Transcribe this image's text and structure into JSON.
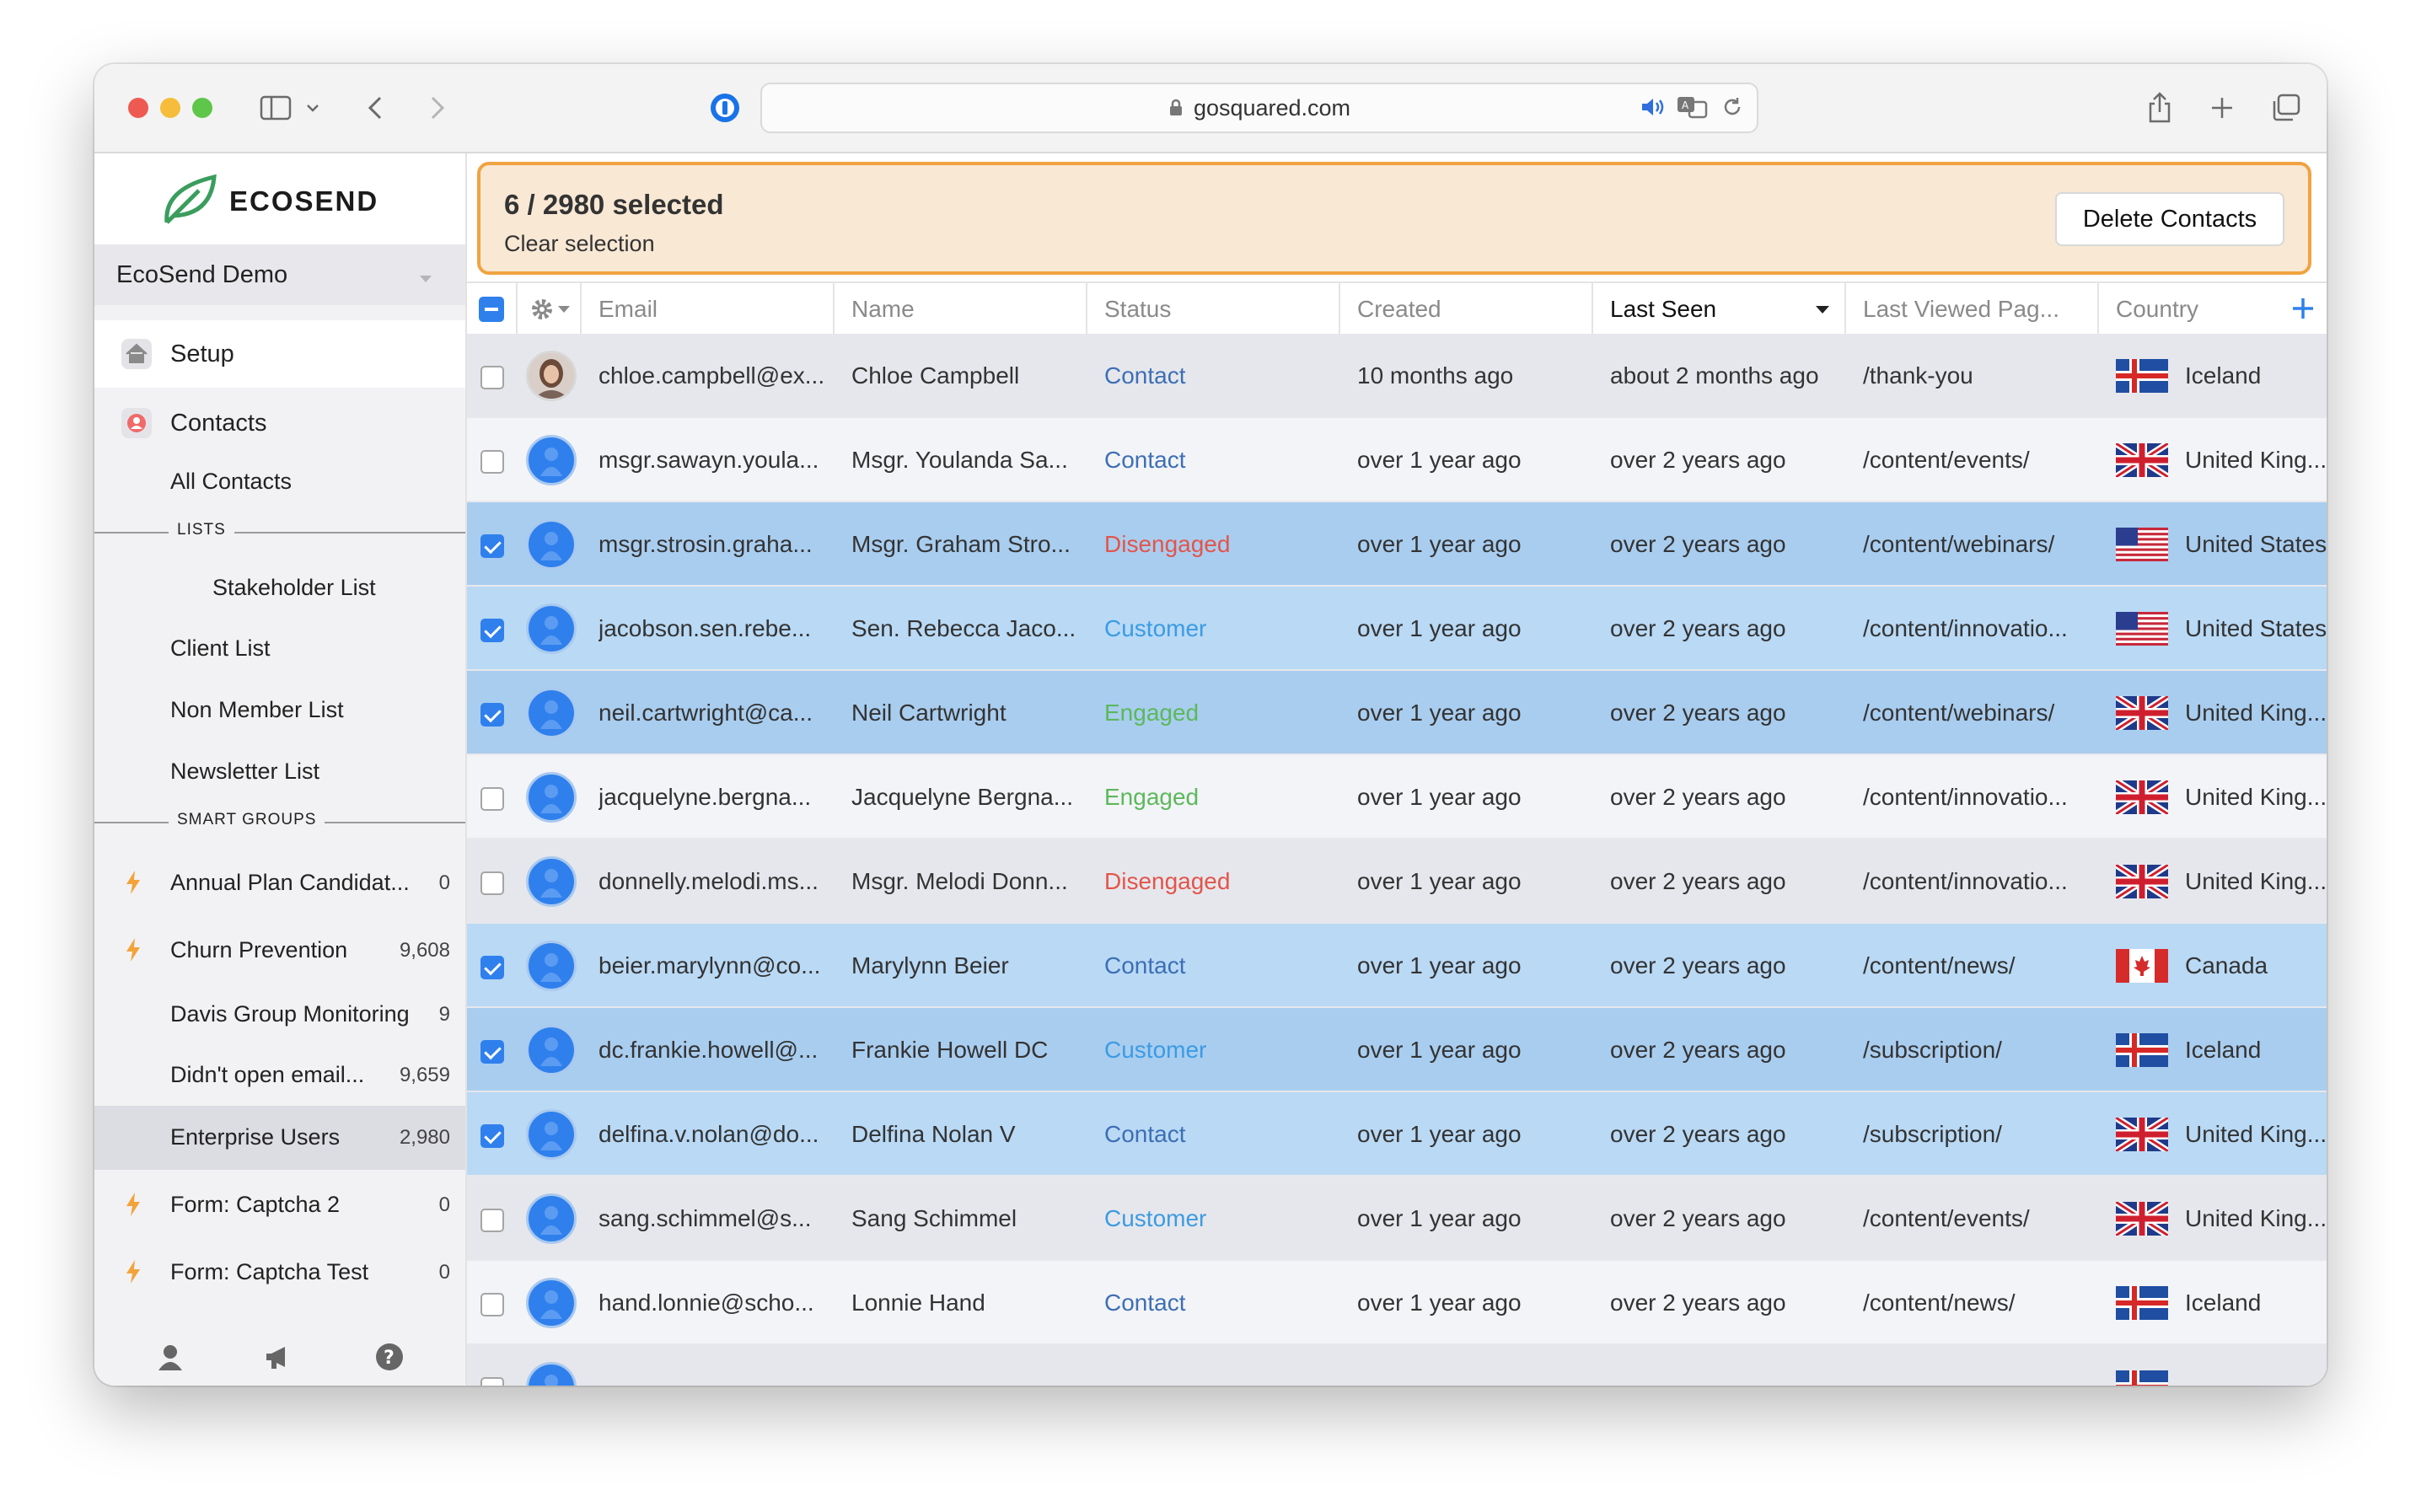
{
  "browser": {
    "url": "gosquared.com"
  },
  "sidebar": {
    "logo": "ECOSEND",
    "account": "EcoSend Demo",
    "setup": "Setup",
    "contacts": "Contacts",
    "all_contacts": "All Contacts",
    "lists_heading": "LISTS",
    "lists": [
      "Stakeholder List",
      "Client List",
      "Non Member List",
      "Newsletter List"
    ],
    "smart_groups_heading": "SMART GROUPS",
    "smart_groups": [
      {
        "label": "Annual Plan Candidat...",
        "count": "0",
        "bolt": true
      },
      {
        "label": "Churn Prevention",
        "count": "9,608",
        "bolt": true
      },
      {
        "label": "Davis Group Monitoring",
        "count": "9",
        "bolt": false
      },
      {
        "label": "Didn't open email...",
        "count": "9,659",
        "bolt": false
      },
      {
        "label": "Enterprise Users",
        "count": "2,980",
        "bolt": false,
        "active": true
      },
      {
        "label": "Form: Captcha 2",
        "count": "0",
        "bolt": true
      },
      {
        "label": "Form: Captcha Test",
        "count": "0",
        "bolt": true
      }
    ]
  },
  "selection": {
    "title": "6 / 2980 selected",
    "clear": "Clear selection",
    "delete_button": "Delete Contacts"
  },
  "table": {
    "columns": [
      "Email",
      "Name",
      "Status",
      "Created",
      "Last Seen",
      "Last Viewed Pag...",
      "Country"
    ],
    "status_colors": {
      "Contact": "#3d6fb4",
      "Customer": "#3c9be3",
      "Engaged": "#5cb85c",
      "Disengaged": "#e2554b"
    },
    "rows": [
      {
        "selected": false,
        "email": "chloe.campbell@ex...",
        "name": "Chloe Campbell",
        "status": "Contact",
        "created": "10 months ago",
        "last_seen": "about 2 months ago",
        "page": "/thank-you",
        "country": "Iceland",
        "flag": "iceland-flag",
        "photo": true
      },
      {
        "selected": false,
        "email": "msgr.sawayn.youla...",
        "name": "Msgr. Youlanda Sa...",
        "status": "Contact",
        "created": "over 1 year ago",
        "last_seen": "over 2 years ago",
        "page": "/content/events/",
        "country": "United King...",
        "flag": "uk-flag"
      },
      {
        "selected": true,
        "email": "msgr.strosin.graha...",
        "name": "Msgr. Graham Stro...",
        "status": "Disengaged",
        "created": "over 1 year ago",
        "last_seen": "over 2 years ago",
        "page": "/content/webinars/",
        "country": "United States",
        "flag": "us-flag"
      },
      {
        "selected": true,
        "email": "jacobson.sen.rebe...",
        "name": "Sen. Rebecca Jaco...",
        "status": "Customer",
        "created": "over 1 year ago",
        "last_seen": "over 2 years ago",
        "page": "/content/innovatio...",
        "country": "United States",
        "flag": "us-flag"
      },
      {
        "selected": true,
        "email": "neil.cartwright@ca...",
        "name": "Neil Cartwright",
        "status": "Engaged",
        "created": "over 1 year ago",
        "last_seen": "over 2 years ago",
        "page": "/content/webinars/",
        "country": "United King...",
        "flag": "uk-flag"
      },
      {
        "selected": false,
        "email": "jacquelyne.bergna...",
        "name": "Jacquelyne Bergna...",
        "status": "Engaged",
        "created": "over 1 year ago",
        "last_seen": "over 2 years ago",
        "page": "/content/innovatio...",
        "country": "United King...",
        "flag": "uk-flag"
      },
      {
        "selected": false,
        "email": "donnelly.melodi.ms...",
        "name": "Msgr. Melodi Donn...",
        "status": "Disengaged",
        "created": "over 1 year ago",
        "last_seen": "over 2 years ago",
        "page": "/content/innovatio...",
        "country": "United King...",
        "flag": "uk-flag"
      },
      {
        "selected": true,
        "email": "beier.marylynn@co...",
        "name": "Marylynn Beier",
        "status": "Contact",
        "created": "over 1 year ago",
        "last_seen": "over 2 years ago",
        "page": "/content/news/",
        "country": "Canada",
        "flag": "canada-flag"
      },
      {
        "selected": true,
        "email": "dc.frankie.howell@...",
        "name": "Frankie Howell DC",
        "status": "Customer",
        "created": "over 1 year ago",
        "last_seen": "over 2 years ago",
        "page": "/subscription/",
        "country": "Iceland",
        "flag": "iceland-flag"
      },
      {
        "selected": true,
        "email": "delfina.v.nolan@do...",
        "name": "Delfina Nolan V",
        "status": "Contact",
        "created": "over 1 year ago",
        "last_seen": "over 2 years ago",
        "page": "/subscription/",
        "country": "United King...",
        "flag": "uk-flag"
      },
      {
        "selected": false,
        "email": "sang.schimmel@s...",
        "name": "Sang Schimmel",
        "status": "Customer",
        "created": "over 1 year ago",
        "last_seen": "over 2 years ago",
        "page": "/content/events/",
        "country": "United King...",
        "flag": "uk-flag"
      },
      {
        "selected": false,
        "email": "hand.lonnie@scho...",
        "name": "Lonnie Hand",
        "status": "Contact",
        "created": "over 1 year ago",
        "last_seen": "over 2 years ago",
        "page": "/content/news/",
        "country": "Iceland",
        "flag": "iceland-flag"
      },
      {
        "selected": false,
        "email": "",
        "name": "",
        "status": "",
        "created": "",
        "last_seen": "",
        "page": "",
        "country": "",
        "flag": "iceland-flag"
      }
    ]
  }
}
